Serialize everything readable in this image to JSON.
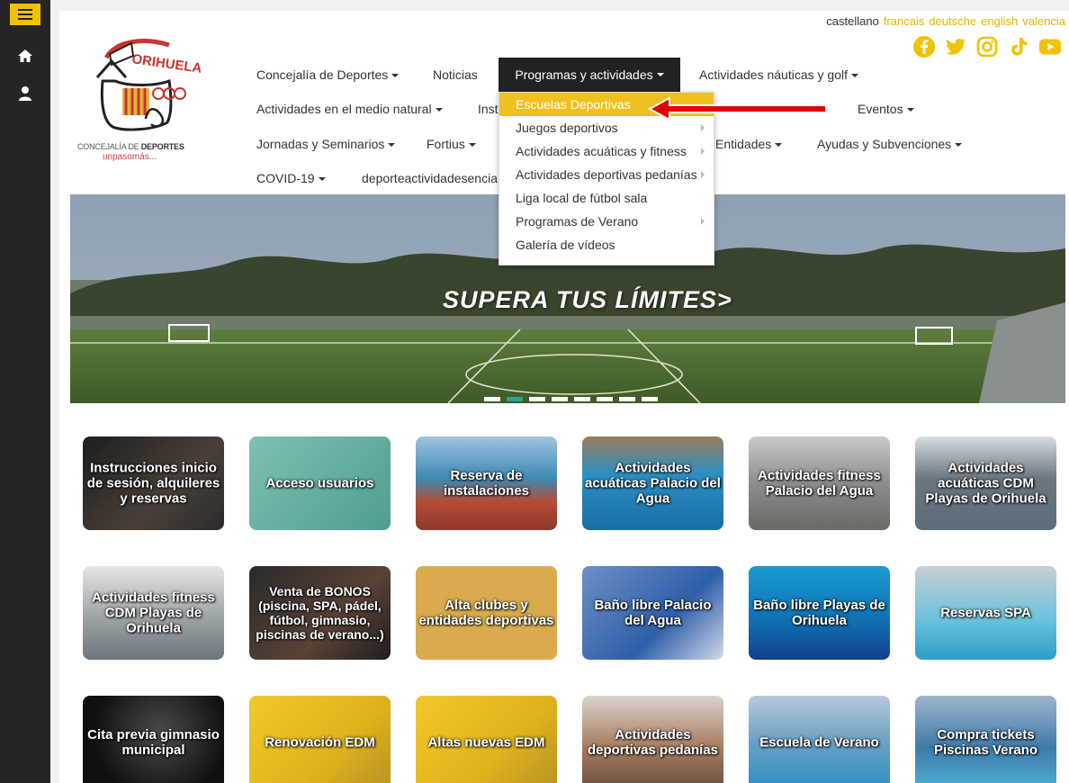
{
  "languages": [
    "castellano",
    "francais",
    "deutsche",
    "english",
    "valencia"
  ],
  "socials": [
    "facebook-icon",
    "twitter-icon",
    "instagram-icon",
    "tiktok-icon",
    "youtube-icon"
  ],
  "colors": {
    "accent": "#f0c020",
    "nav_active": "#222222",
    "dot_active": "#29a39a",
    "arrow": "#e00000"
  },
  "logo": {
    "line1_a": "CONCEJALÍA DE ",
    "line1_b": "DEPORTES",
    "line2": "unpasomás..."
  },
  "nav": {
    "concejalia": "Concejalía de Deportes",
    "noticias": "Noticias",
    "programas": "Programas y actividades",
    "nauticas": "Actividades náuticas y golf",
    "medio_natural": "Actividades en el medio natural",
    "inst": "Inst",
    "eventos": "Eventos",
    "jornadas": "Jornadas y Seminarios",
    "fortius": "Fortius",
    "entidades": "Entidades",
    "ayudas": "Ayudas y Subvenciones",
    "covid": "COVID-19",
    "deporte_esencial": "deporteactividadesencia"
  },
  "dropdown": [
    "Escuelas Deportivas",
    "Juegos deportivos",
    "Actividades acuáticas y fitness",
    "Actividades deportivas pedanías",
    "Liga local de fútbol sala",
    "Programas de Verano",
    "Galería de vídeos"
  ],
  "hero": {
    "text": "SUPERA TUS LÍMITES>"
  },
  "tiles": [
    "Instrucciones inicio de sesión, alquileres y reservas",
    "Acceso usuarios",
    "Reserva de instalaciones",
    "Actividades acuáticas Palacio del Agua",
    "Actividades fitness Palacio del Agua",
    "Actividades acuáticas CDM Playas de Orihuela",
    "Actividades fitness CDM Playas de Orihuela",
    "Venta de BONOS (piscina, SPA, pádel, fútbol, gimnasio, piscinas de verano...)",
    "Alta clubes y entidades deportivas",
    "Baño libre Palacio del Agua",
    "Baño libre Playas de Orihuela",
    "Reservas SPA",
    "Cita previa gimnasio municipal",
    "Renovación EDM",
    "Altas nuevas EDM",
    "Actividades deportivas pedanías",
    "Escuela de Verano",
    "Compra tickets Piscinas Verano"
  ]
}
